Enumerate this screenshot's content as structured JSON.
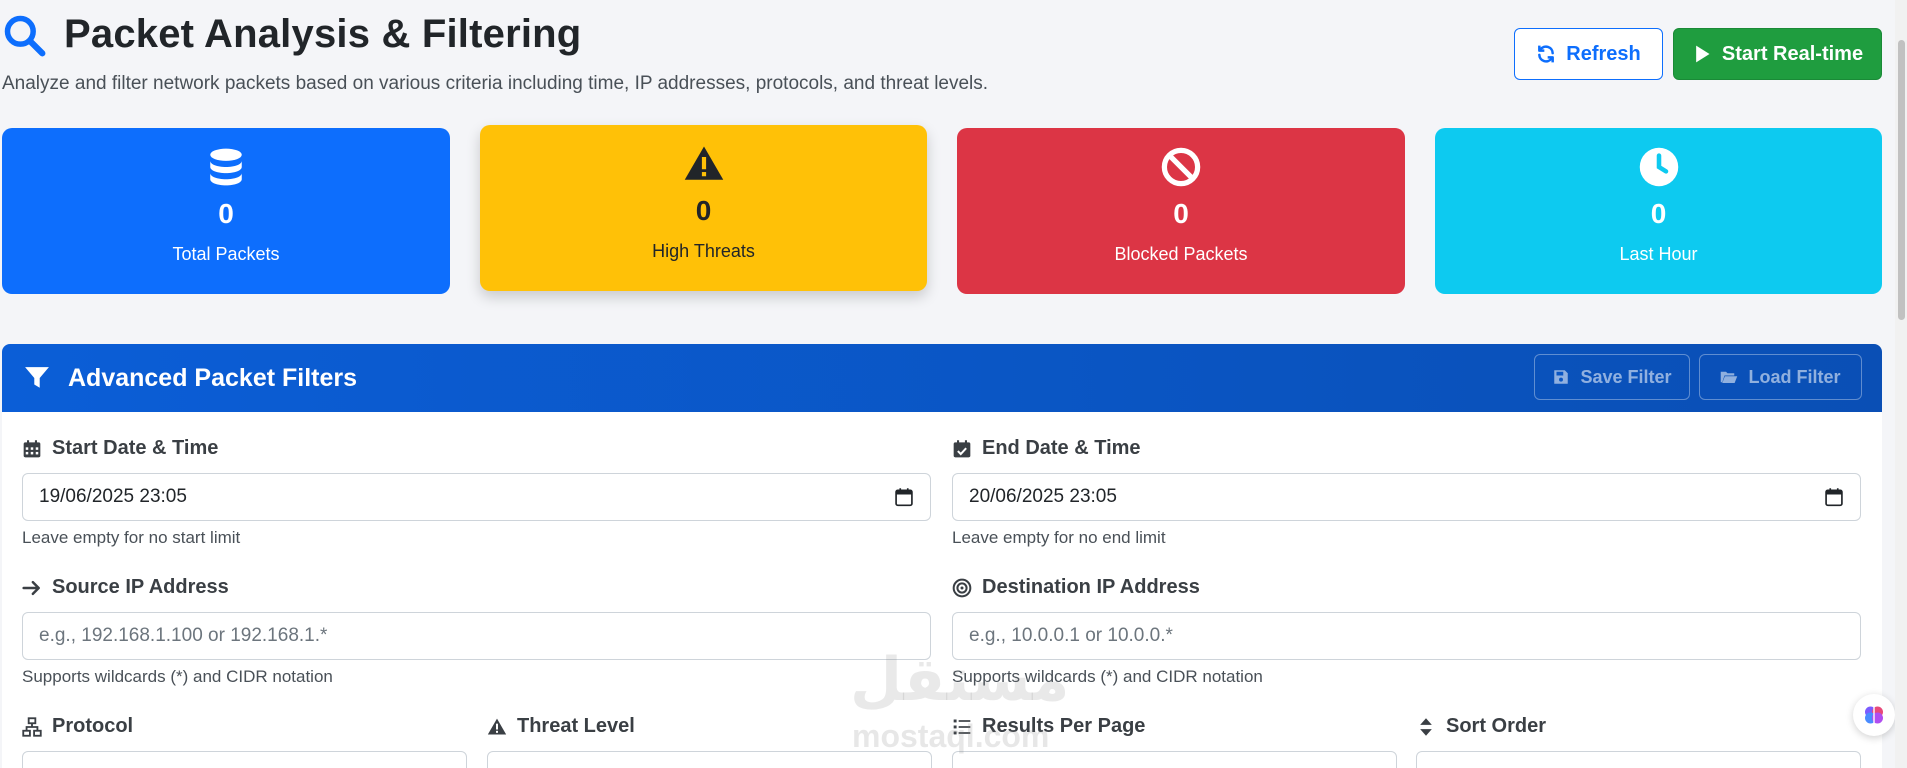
{
  "header": {
    "title": "Packet Analysis & Filtering",
    "subtitle": "Analyze and filter network packets based on various criteria including time, IP addresses, protocols, and threat levels.",
    "refresh_label": "Refresh",
    "start_label": "Start Real-time"
  },
  "stats": [
    {
      "value": "0",
      "label": "Total Packets",
      "icon": "database-icon"
    },
    {
      "value": "0",
      "label": "High Threats",
      "icon": "warning-icon"
    },
    {
      "value": "0",
      "label": "Blocked Packets",
      "icon": "ban-icon"
    },
    {
      "value": "0",
      "label": "Last Hour",
      "icon": "clock-icon"
    }
  ],
  "filters": {
    "title": "Advanced Packet Filters",
    "save_label": "Save Filter",
    "load_label": "Load Filter",
    "start_date": {
      "label": "Start Date & Time",
      "value": "19/06/2025 23:05",
      "hint": "Leave empty for no start limit"
    },
    "end_date": {
      "label": "End Date & Time",
      "value": "20/06/2025 23:05",
      "hint": "Leave empty for no end limit"
    },
    "source_ip": {
      "label": "Source IP Address",
      "placeholder": "e.g., 192.168.1.100 or 192.168.1.*",
      "hint": "Supports wildcards (*) and CIDR notation"
    },
    "dest_ip": {
      "label": "Destination IP Address",
      "placeholder": "e.g., 10.0.0.1 or 10.0.0.*",
      "hint": "Supports wildcards (*) and CIDR notation"
    },
    "protocol": {
      "label": "Protocol"
    },
    "threat_level": {
      "label": "Threat Level"
    },
    "results_per_page": {
      "label": "Results Per Page"
    },
    "sort_order": {
      "label": "Sort Order"
    }
  },
  "watermark": {
    "text": "مستقل",
    "sub": "mostaql.com"
  },
  "colors": {
    "primary": "#0d6efd",
    "success": "#1f9d3f",
    "warning": "#ffc107",
    "danger": "#dc3545",
    "info": "#0dcaf0"
  }
}
